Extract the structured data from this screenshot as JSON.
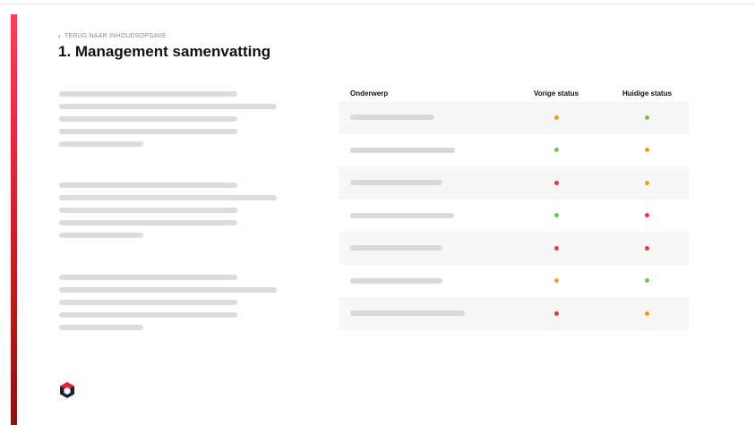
{
  "nav": {
    "back_label": "TERUG NAAR INHOUDSOPGAVE"
  },
  "page": {
    "title": "1. Management samenvatting"
  },
  "table": {
    "headers": {
      "subject": "Onderwerp",
      "previous": "Vorige status",
      "current": "Huidige status"
    },
    "rows": [
      {
        "previous": "orange",
        "current": "green"
      },
      {
        "previous": "green",
        "current": "orange"
      },
      {
        "previous": "red",
        "current": "orange"
      },
      {
        "previous": "green",
        "current": "red"
      },
      {
        "previous": "red",
        "current": "red"
      },
      {
        "previous": "orange",
        "current": "green"
      },
      {
        "previous": "red",
        "current": "orange"
      }
    ]
  },
  "colors": {
    "accent": "#e1263d",
    "status": {
      "green": "#6cc24a",
      "orange": "#f59a1b",
      "red": "#e8344a"
    }
  },
  "icons": {
    "back": "chevron-left-icon",
    "logo": "hexagon-logo-icon"
  }
}
